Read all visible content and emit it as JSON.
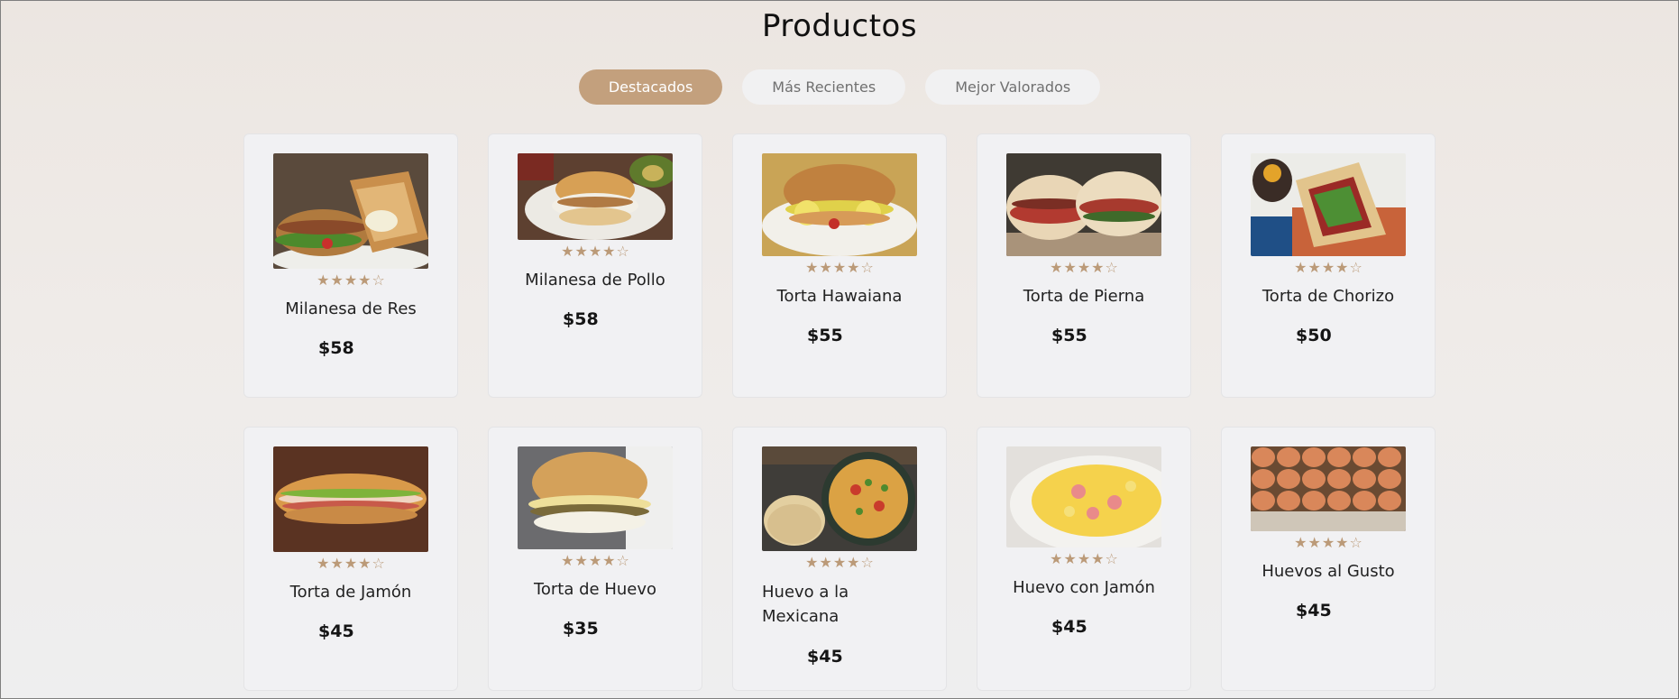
{
  "page": {
    "title": "Productos"
  },
  "tabs": [
    {
      "label": "Destacados",
      "active": true
    },
    {
      "label": "Más Recientes",
      "active": false
    },
    {
      "label": "Mejor Valorados",
      "active": false
    }
  ],
  "rating_glyphs": {
    "full": "★",
    "empty": "☆"
  },
  "colors": {
    "accent": "#c3a07d",
    "star": "#bb9a78",
    "card": "#f1f1f3"
  },
  "products": [
    {
      "name": "Milanesa de Res",
      "price": "$58",
      "rating": 4
    },
    {
      "name": "Milanesa de Pollo",
      "price": "$58",
      "rating": 4
    },
    {
      "name": "Torta Hawaiana",
      "price": "$55",
      "rating": 4
    },
    {
      "name": "Torta de Pierna",
      "price": "$55",
      "rating": 4
    },
    {
      "name": "Torta de Chorizo",
      "price": "$50",
      "rating": 4
    },
    {
      "name": "Torta de Jamón",
      "price": "$45",
      "rating": 4
    },
    {
      "name": "Torta de Huevo",
      "price": "$35",
      "rating": 4
    },
    {
      "name": "Huevo a la Mexicana",
      "price": "$45",
      "rating": 4
    },
    {
      "name": "Huevo con Jamón",
      "price": "$45",
      "rating": 4
    },
    {
      "name": "Huevos al Gusto",
      "price": "$45",
      "rating": 4
    }
  ]
}
